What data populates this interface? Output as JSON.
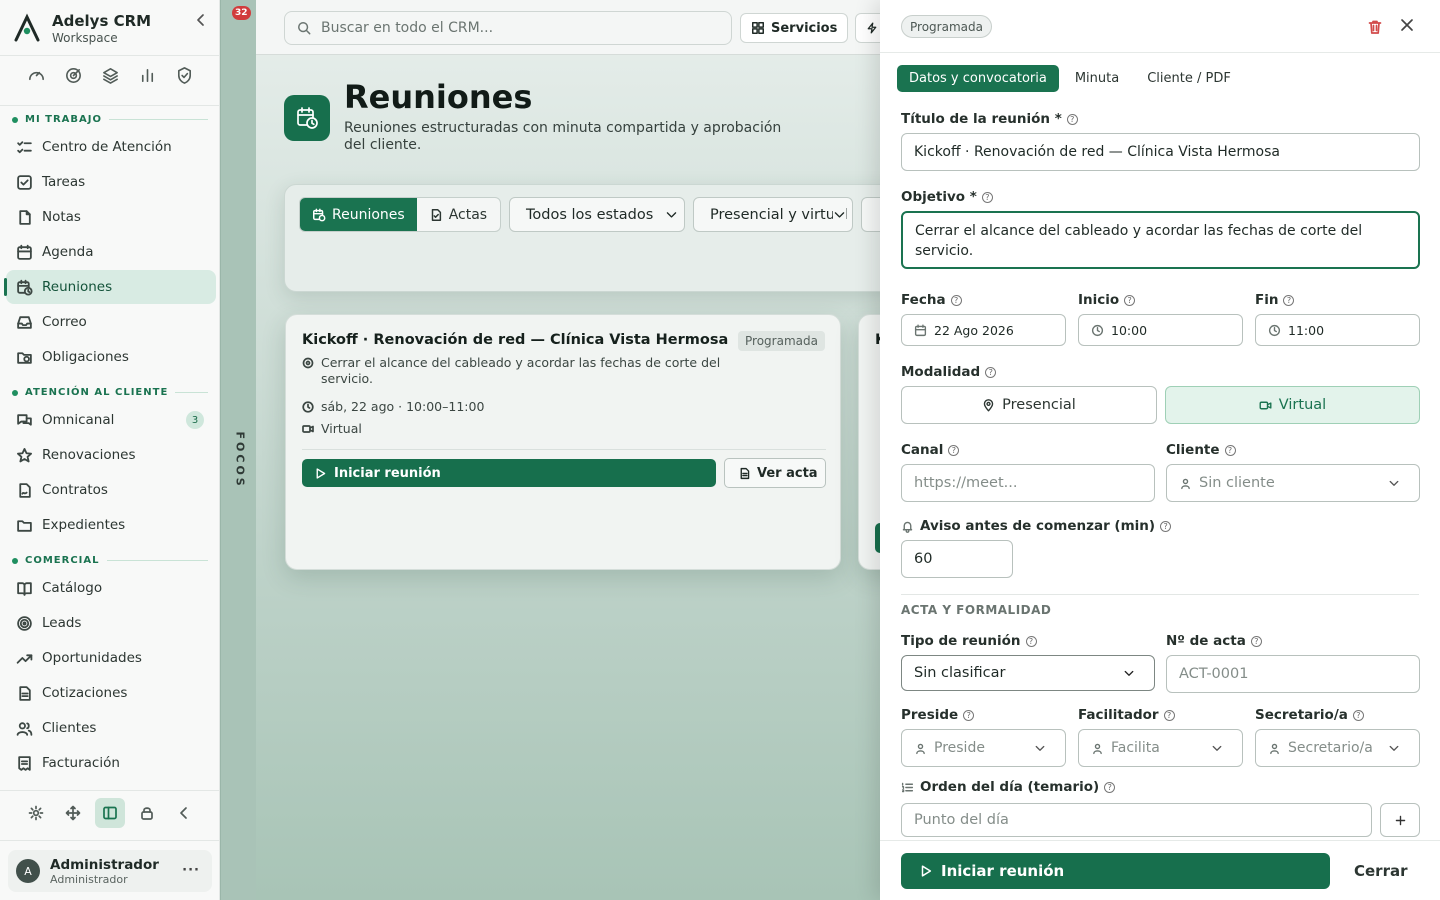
{
  "brand": {
    "title": "Adelys CRM",
    "subtitle": "Workspace"
  },
  "quick_icons": [
    "gauge-icon",
    "target-icon",
    "layers-icon",
    "bar-chart-icon",
    "shield-icon"
  ],
  "sections": {
    "mi_trabajo": "MI TRABAJO",
    "atencion": "ATENCIÓN AL CLIENTE",
    "comercial": "COMERCIAL"
  },
  "nav": {
    "centro": "Centro de Atención",
    "tareas": "Tareas",
    "notas": "Notas",
    "agenda": "Agenda",
    "reuniones": "Reuniones",
    "correo": "Correo",
    "obligaciones": "Obligaciones",
    "omnicanal": "Omnicanal",
    "omnicanal_badge": "3",
    "renovaciones": "Renovaciones",
    "contratos": "Contratos",
    "expedientes": "Expedientes",
    "catalogo": "Catálogo",
    "leads": "Leads",
    "oportunidades": "Oportunidades",
    "cotizaciones": "Cotizaciones",
    "clientes": "Clientes",
    "facturacion": "Facturación"
  },
  "user": {
    "initial": "A",
    "name": "Administrador",
    "role": "Administrador",
    "more": "···"
  },
  "focos": {
    "label": "FOCOS",
    "notifications": "32"
  },
  "topbar": {
    "search_placeholder": "Buscar en todo el CRM...",
    "servicios": "Servicios"
  },
  "page": {
    "title": "Reuniones",
    "subtitle": "Reuniones estructuradas con minuta compartida y aprobación del cliente."
  },
  "filters": {
    "seg_reuniones": "Reuniones",
    "seg_actas": "Actas",
    "estado": "Todos los estados",
    "modalidad": "Presencial y virtual"
  },
  "meeting_card": {
    "title": "Kickoff · Renovación de red — Clínica Vista Hermosa",
    "status": "Programada",
    "objective": "Cerrar el alcance del cableado y acordar las fechas de corte del servicio.",
    "when": "sáb, 22 ago · 10:00–11:00",
    "mode": "Virtual",
    "start_button": "Iniciar reunión",
    "minutes_button": "Ver acta"
  },
  "card2_peek": {
    "title_initial": "K"
  },
  "panel": {
    "status": "Programada",
    "tabs": [
      "Datos y convocatoria",
      "Minuta",
      "Cliente / PDF"
    ],
    "titulo_label": "Título de la reunión *",
    "titulo_value": "Kickoff · Renovación de red — Clínica Vista Hermosa",
    "objetivo_label": "Objetivo *",
    "objetivo_value": "Cerrar el alcance del cableado y acordar las fechas de corte del servicio.",
    "fecha_label": "Fecha",
    "fecha_value": "22 Ago 2026",
    "inicio_label": "Inicio",
    "inicio_value": "10:00",
    "fin_label": "Fin",
    "fin_value": "11:00",
    "modalidad_label": "Modalidad",
    "presencial": "Presencial",
    "virtual": "Virtual",
    "canal_label": "Canal",
    "canal_placeholder": "https://meet...",
    "cliente_label": "Cliente",
    "cliente_value": "Sin cliente",
    "aviso_label": "Aviso antes de comenzar (min)",
    "aviso_value": "60",
    "acta_section": "ACTA Y FORMALIDAD",
    "tipo_label": "Tipo de reunión",
    "tipo_value": "Sin clasificar",
    "nacta_label": "Nº de acta",
    "nacta_placeholder": "ACT-0001",
    "preside_label": "Preside",
    "preside_value": "Preside",
    "facilitador_label": "Facilitador",
    "facilitador_value": "Facilita",
    "secretario_label": "Secretario/a",
    "secretario_value": "Secretario/a",
    "orden_label": "Orden del día (temario)",
    "orden_placeholder": "Punto del día",
    "footer_start": "Iniciar reunión",
    "footer_close": "Cerrar"
  },
  "colors": {
    "accent": "#1a7350",
    "danger": "#d24a4a"
  }
}
